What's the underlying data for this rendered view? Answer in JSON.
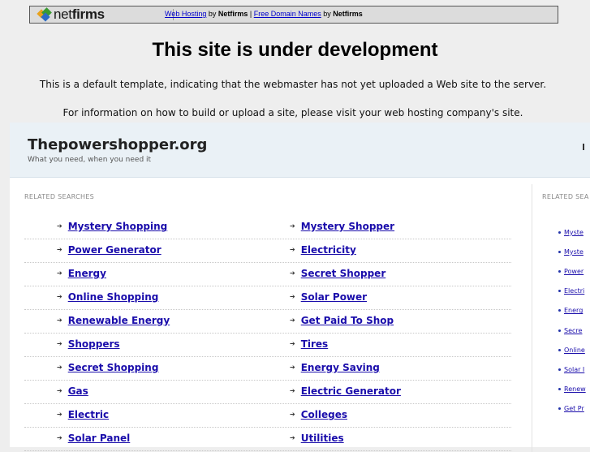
{
  "topbar": {
    "logo_net": "net",
    "logo_firms": "firms",
    "link1": "Web Hosting",
    "by1": " by ",
    "brand1": "Netfirms",
    "sep": " | ",
    "link2": "Free Domain Names",
    "by2": " by ",
    "brand2": "Netfirms"
  },
  "headline": "This site is under development",
  "notice1": "This is a default template, indicating that the webmaster has not yet uploaded a Web site to the server.",
  "notice2": "For information on how to build or upload a site, please visit your web hosting company's site.",
  "parked": {
    "site_title": "Thepowershopper.org",
    "site_tagline": "What you need, when you need it",
    "related_label": "RELATED SEARCHES",
    "related_label_right": "RELATED SEA",
    "arrow_glyph": "➔",
    "left_links": [
      "Mystery Shopping",
      "Power Generator",
      "Energy",
      "Online Shopping",
      "Renewable Energy",
      "Shoppers",
      "Secret Shopping",
      "Gas",
      "Electric",
      "Solar Panel"
    ],
    "right_links": [
      "Mystery Shopper",
      "Electricity",
      "Secret Shopper",
      "Solar Power",
      "Get Paid To Shop",
      "Tires",
      "Energy Saving",
      "Electric Generator",
      "Colleges",
      "Utilities"
    ],
    "side_links": [
      "Myste",
      "Myste",
      "Power",
      "Electri",
      "Energ",
      "Secre",
      "Online",
      "Solar I",
      "Renew",
      "Get Pr"
    ]
  },
  "colors": {
    "page_bg": "#eeeeee",
    "header_bg": "#eaf1f6",
    "link": "#1a0dab"
  },
  "icons": {
    "logo": "netfirms-logo-icon",
    "row_arrow": "arrow-right-icon",
    "side_bullet": "bullet-icon"
  }
}
